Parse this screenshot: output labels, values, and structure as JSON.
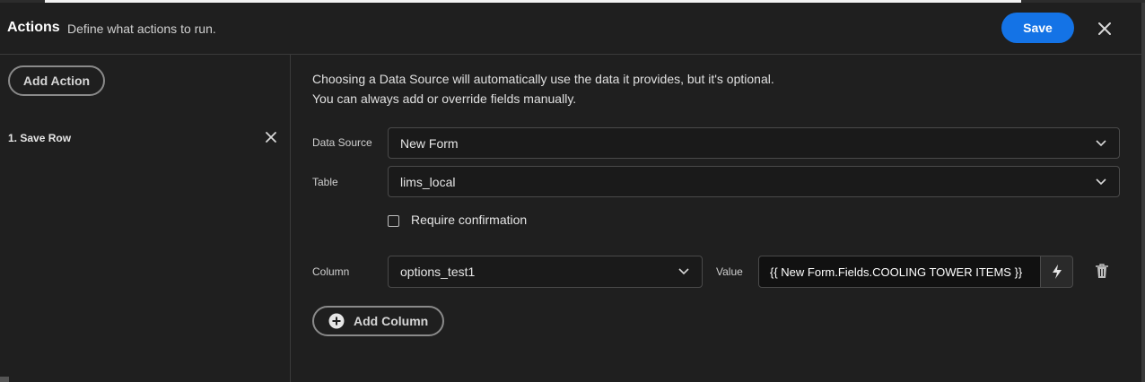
{
  "header": {
    "title": "Actions",
    "subtitle": "Define what actions to run.",
    "save_label": "Save"
  },
  "sidebar": {
    "add_action_label": "Add Action",
    "actions": [
      {
        "label": "1. Save Row"
      }
    ]
  },
  "main": {
    "description_line1": "Choosing a Data Source will automatically use the data it provides, but it's optional.",
    "description_line2": "You can always add or override fields manually.",
    "data_source": {
      "label": "Data Source",
      "value": "New Form"
    },
    "table": {
      "label": "Table",
      "value": "lims_local"
    },
    "require_confirmation": {
      "label": "Require confirmation",
      "checked": false
    },
    "column_row": {
      "column_label": "Column",
      "column_value": "options_test1",
      "value_label": "Value",
      "value_text": "{{ New Form.Fields.COOLING TOWER ITEMS  }}"
    },
    "add_column_label": "Add Column"
  },
  "colors": {
    "accent": "#1473e6",
    "background": "#1f1f1f",
    "border": "#4a4a4a"
  },
  "icons": [
    "close-icon",
    "chevron-down-icon",
    "lightning-bolt-icon",
    "trash-icon",
    "plus-circle-icon"
  ]
}
